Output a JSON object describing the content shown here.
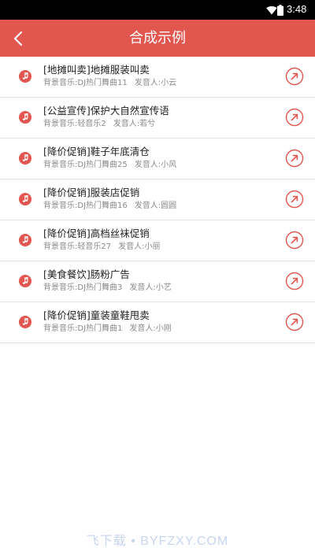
{
  "status_bar": {
    "time": "3:48",
    "icons": [
      "wifi-icon",
      "battery-icon"
    ]
  },
  "app_bar": {
    "title": "合成示例",
    "back_icon": "chevron-left-icon"
  },
  "colors": {
    "accent": "#e25650",
    "title_text": "#222222",
    "meta_text": "#8a8a8a",
    "divider": "#e2e2e2"
  },
  "items": [
    {
      "title": "[地摊叫卖]地摊服装叫卖",
      "music": "背景音乐:DJ热门舞曲11",
      "speaker": "发音人:小云"
    },
    {
      "title": "[公益宣传]保护大自然宣传语",
      "music": "背景音乐:轻音乐2",
      "speaker": "发音人:若兮"
    },
    {
      "title": "[降价促销]鞋子年底清仓",
      "music": "背景音乐:DJ热门舞曲25",
      "speaker": "发音人:小风"
    },
    {
      "title": "[降价促销]服装店促销",
      "music": "背景音乐:DJ热门舞曲16",
      "speaker": "发音人:圆圆"
    },
    {
      "title": "[降价促销]高档丝袜促销",
      "music": "背景音乐:轻音乐27",
      "speaker": "发音人:小丽"
    },
    {
      "title": "[美食餐饮]肠粉广告",
      "music": "背景音乐:DJ热门舞曲3",
      "speaker": "发音人:小艺"
    },
    {
      "title": "[降价促销]童装童鞋甩卖",
      "music": "背景音乐:DJ热门舞曲1",
      "speaker": "发音人:小刚"
    }
  ],
  "item_icons": {
    "leading": "music-note-icon",
    "trailing": "arrow-up-right-circle-icon"
  },
  "watermark": "飞下载 • BYFZXY.COM"
}
